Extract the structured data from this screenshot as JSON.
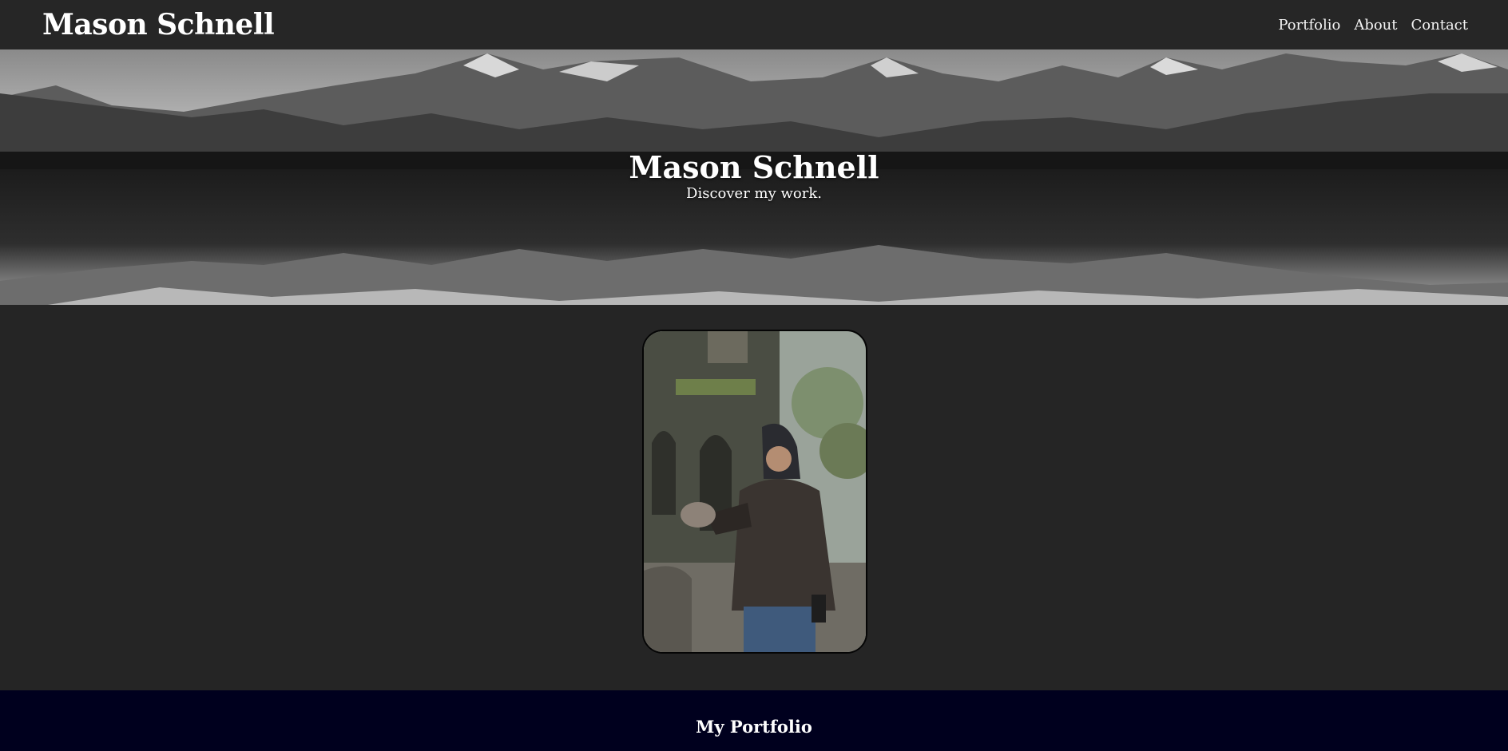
{
  "navbar": {
    "brand": "Mason Schnell",
    "links": [
      {
        "label": "Portfolio"
      },
      {
        "label": "About"
      },
      {
        "label": "Contact"
      }
    ]
  },
  "hero": {
    "title": "Mason Schnell",
    "subtitle": "Discover my work."
  },
  "portfolio": {
    "heading": "My Portfolio"
  },
  "colors": {
    "page_background": "#252525",
    "navbar_background": "#262626",
    "portfolio_band_background": "#00001e",
    "text": "#ffffff"
  }
}
